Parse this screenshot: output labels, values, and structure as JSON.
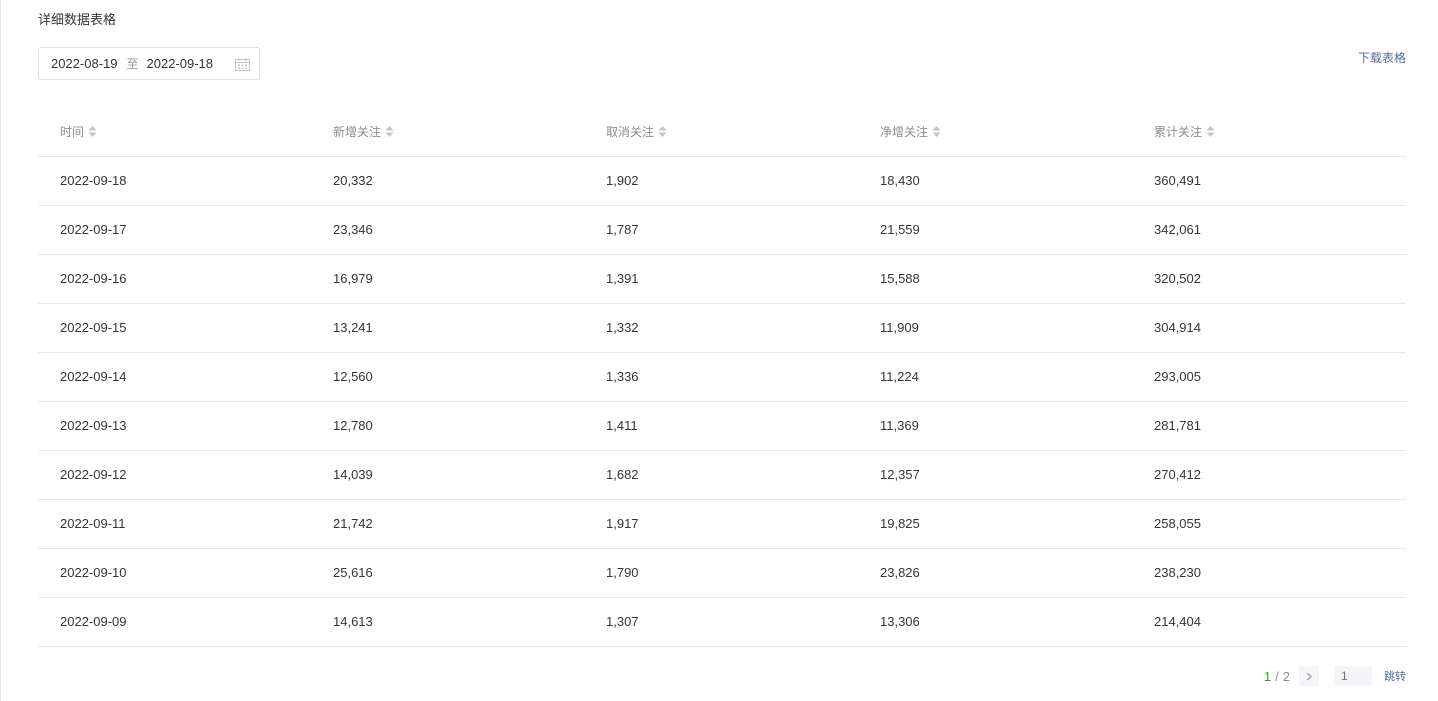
{
  "section": {
    "title": "详细数据表格"
  },
  "date_range": {
    "start": "2022-08-19",
    "separator": "至",
    "end": "2022-09-18",
    "icon": "calendar-icon"
  },
  "download_label": "下载表格",
  "table": {
    "headers": [
      "时间",
      "新增关注",
      "取消关注",
      "净增关注",
      "累计关注"
    ],
    "rows": [
      [
        "2022-09-18",
        "20,332",
        "1,902",
        "18,430",
        "360,491"
      ],
      [
        "2022-09-17",
        "23,346",
        "1,787",
        "21,559",
        "342,061"
      ],
      [
        "2022-09-16",
        "16,979",
        "1,391",
        "15,588",
        "320,502"
      ],
      [
        "2022-09-15",
        "13,241",
        "1,332",
        "11,909",
        "304,914"
      ],
      [
        "2022-09-14",
        "12,560",
        "1,336",
        "11,224",
        "293,005"
      ],
      [
        "2022-09-13",
        "12,780",
        "1,411",
        "11,369",
        "281,781"
      ],
      [
        "2022-09-12",
        "14,039",
        "1,682",
        "12,357",
        "270,412"
      ],
      [
        "2022-09-11",
        "21,742",
        "1,917",
        "19,825",
        "258,055"
      ],
      [
        "2022-09-10",
        "25,616",
        "1,790",
        "23,826",
        "238,230"
      ],
      [
        "2022-09-09",
        "14,613",
        "1,307",
        "13,306",
        "214,404"
      ]
    ]
  },
  "pagination": {
    "current": "1",
    "total": "2",
    "slash": "/",
    "jump_placeholder": "1",
    "jump_label": "跳转",
    "current_color": "#1aad19"
  },
  "colors": {
    "link": "#576b95",
    "border": "#e7e7eb",
    "header_text": "#8c8c8c"
  }
}
